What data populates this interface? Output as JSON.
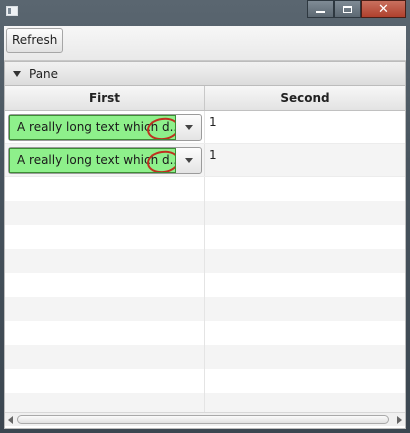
{
  "window": {
    "app_icon": "window-app-icon",
    "controls": {
      "minimize": "minimize-icon",
      "maximize": "maximize-icon",
      "close": "close-icon",
      "close_glyph": "✕"
    }
  },
  "toolbar": {
    "refresh_label": "Refresh"
  },
  "pane": {
    "title": "Pane",
    "expanded": true
  },
  "table": {
    "columns": [
      "First",
      "Second"
    ],
    "rows": [
      {
        "first": "A really long text which d...",
        "second": "1"
      },
      {
        "first": "A really long text which d...",
        "second": "1"
      }
    ],
    "empty_rows": 10
  },
  "colors": {
    "combo_fill": "#8ef08b",
    "annotation_circle": "#c0311f",
    "close_button": "#b0402d"
  }
}
